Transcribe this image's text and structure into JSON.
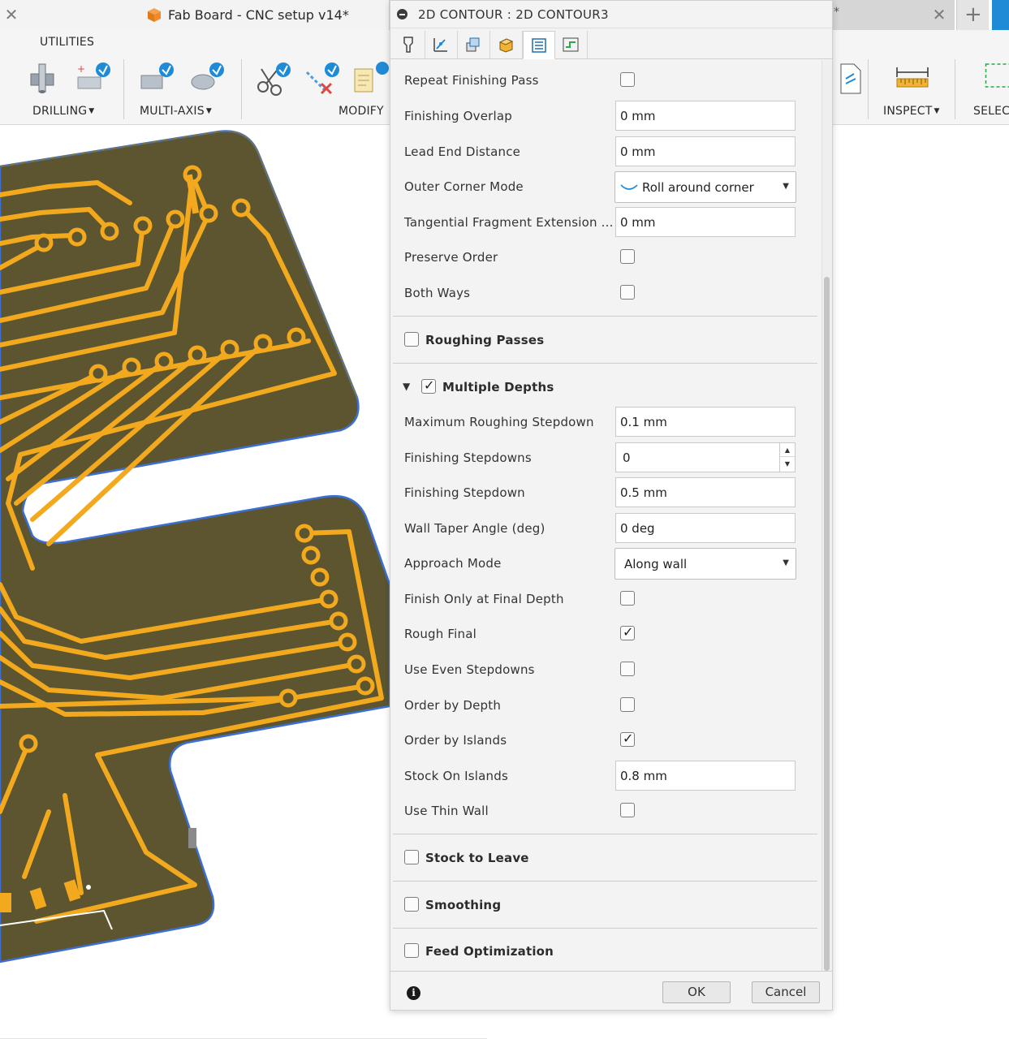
{
  "window": {
    "document_title": "Fab Board - CNC setup v14*",
    "other_tab_suffix": "*"
  },
  "toolbar": {
    "utilities": "UTILITIES",
    "drilling": "DRILLING",
    "multi_axis": "MULTI-AXIS",
    "modify": "MODIFY",
    "inspect": "INSPECT",
    "select": "SELEC"
  },
  "dialog": {
    "title": "2D CONTOUR : 2D CONTOUR3",
    "tabs": [
      "tool",
      "geometry",
      "heights",
      "passes",
      "linking"
    ],
    "rows_top": [
      {
        "label": "Repeat Finishing Pass",
        "type": "checkbox",
        "checked": false
      },
      {
        "label": "Finishing Overlap",
        "type": "input",
        "value": "0 mm"
      },
      {
        "label": "Lead End Distance",
        "type": "input",
        "value": "0 mm"
      },
      {
        "label": "Outer Corner Mode",
        "type": "select",
        "value": "Roll around corner"
      },
      {
        "label": "Tangential Fragment Extension ...",
        "type": "input",
        "value": "0 mm"
      },
      {
        "label": "Preserve Order",
        "type": "checkbox",
        "checked": false
      },
      {
        "label": "Both Ways",
        "type": "checkbox",
        "checked": false
      }
    ],
    "roughing_passes": {
      "label": "Roughing Passes",
      "checked": false
    },
    "multiple_depths": {
      "label": "Multiple Depths",
      "checked": true,
      "rows": [
        {
          "label": "Maximum Roughing Stepdown",
          "type": "input",
          "value": "0.1 mm"
        },
        {
          "label": "Finishing Stepdowns",
          "type": "spinner",
          "value": "0"
        },
        {
          "label": "Finishing Stepdown",
          "type": "input",
          "value": "0.5 mm"
        },
        {
          "label": "Wall Taper Angle (deg)",
          "type": "input",
          "value": "0 deg"
        },
        {
          "label": "Approach Mode",
          "type": "select",
          "value": "Along wall"
        },
        {
          "label": "Finish Only at Final Depth",
          "type": "checkbox",
          "checked": false
        },
        {
          "label": "Rough Final",
          "type": "checkbox",
          "checked": true
        },
        {
          "label": "Use Even Stepdowns",
          "type": "checkbox",
          "checked": false
        },
        {
          "label": "Order by Depth",
          "type": "checkbox",
          "checked": false
        },
        {
          "label": "Order by Islands",
          "type": "checkbox",
          "checked": true
        },
        {
          "label": "Stock On Islands",
          "type": "input",
          "value": "0.8 mm"
        },
        {
          "label": "Use Thin Wall",
          "type": "checkbox",
          "checked": false
        }
      ]
    },
    "stock_to_leave": {
      "label": "Stock to Leave",
      "checked": false
    },
    "smoothing": {
      "label": "Smoothing",
      "checked": false
    },
    "feed_optimization": {
      "label": "Feed Optimization",
      "checked": false
    },
    "ok": "OK",
    "cancel": "Cancel"
  },
  "colors": {
    "board": "#5c5530",
    "board_edge": "#3e3a20",
    "trace": "#f2a91e",
    "board_outline": "#3b6fd1",
    "accent_blue": "#1f8bd7"
  }
}
